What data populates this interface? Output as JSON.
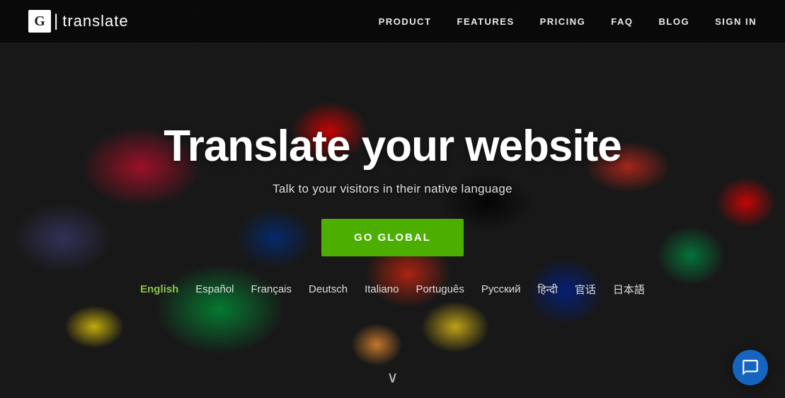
{
  "logo": {
    "g_letter": "G",
    "pipe": "|",
    "name": "translate"
  },
  "nav": {
    "links": [
      {
        "id": "product",
        "label": "PRODUCT"
      },
      {
        "id": "features",
        "label": "FEATURES"
      },
      {
        "id": "pricing",
        "label": "PRICING"
      },
      {
        "id": "faq",
        "label": "FAQ"
      },
      {
        "id": "blog",
        "label": "BLOG"
      }
    ],
    "signin_label": "SIGN IN"
  },
  "hero": {
    "title": "Translate your website",
    "subtitle": "Talk to your visitors in their native language",
    "cta_label": "GO GLOBAL"
  },
  "languages": [
    {
      "id": "english",
      "label": "English",
      "active": true
    },
    {
      "id": "espanol",
      "label": "Español",
      "active": false
    },
    {
      "id": "francais",
      "label": "Français",
      "active": false
    },
    {
      "id": "deutsch",
      "label": "Deutsch",
      "active": false
    },
    {
      "id": "italiano",
      "label": "Italiano",
      "active": false
    },
    {
      "id": "portugues",
      "label": "Português",
      "active": false
    },
    {
      "id": "russian",
      "label": "Русский",
      "active": false
    },
    {
      "id": "hindi",
      "label": "हिन्दी",
      "active": false
    },
    {
      "id": "chinese",
      "label": "官话",
      "active": false
    },
    {
      "id": "japanese",
      "label": "日本語",
      "active": false
    }
  ],
  "scroll_arrow": "∨",
  "chat": {
    "icon_title": "Chat support"
  }
}
